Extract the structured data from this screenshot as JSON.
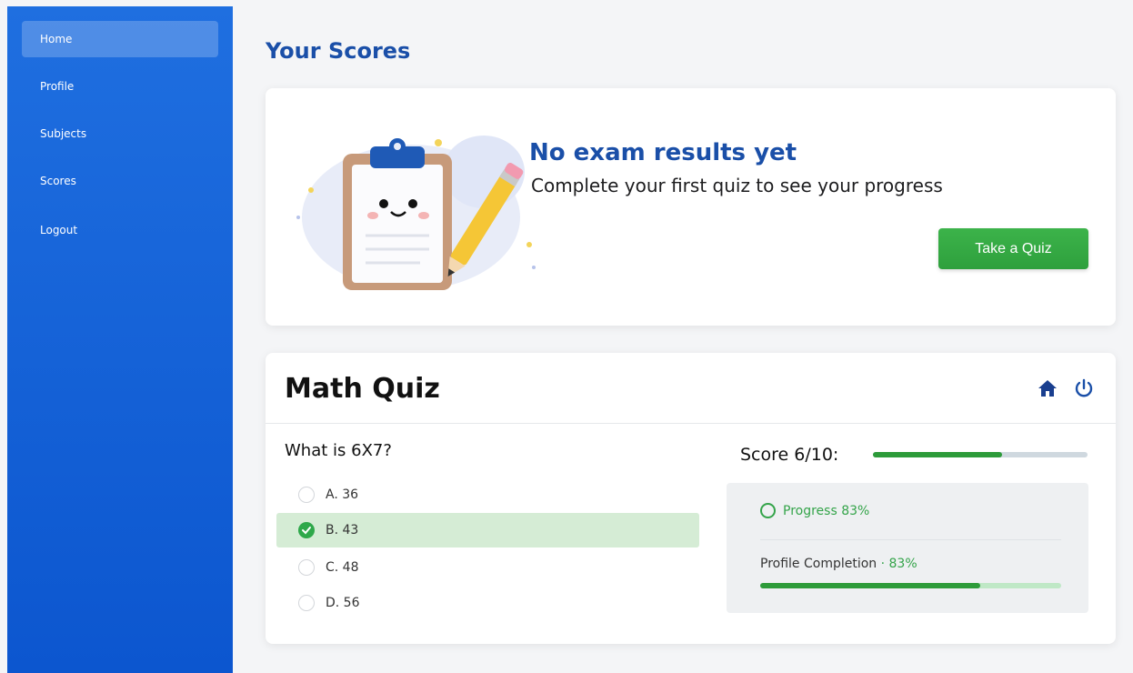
{
  "sidebar": {
    "items": [
      {
        "label": "Home",
        "active": true
      },
      {
        "label": "Profile"
      },
      {
        "label": "Subjects"
      },
      {
        "label": "Scores"
      },
      {
        "label": "Logout"
      }
    ]
  },
  "page": {
    "title": "Your Scores"
  },
  "empty_state": {
    "illustration": "clipboard-pencil-illustration",
    "title": "No exam results yet",
    "subtitle": "Complete your first quiz to see your progress",
    "button_label": "Take a Quiz"
  },
  "quiz": {
    "title": "Math Quiz",
    "header_icons": [
      "home-icon",
      "power-icon"
    ],
    "question": "What is 6X7?",
    "options": [
      {
        "label": "A. 36",
        "selected": false
      },
      {
        "label": "B. 43",
        "selected": true
      },
      {
        "label": "C. 48",
        "selected": false
      },
      {
        "label": "D. 56",
        "selected": false
      }
    ],
    "score_label": "Score 6/10:",
    "score_fraction": 0.6,
    "progress_label": "Progress 83%",
    "profile_completion_label": "Profile Completion",
    "profile_completion_pct_text": "83%",
    "profile_completion_fraction": 0.73
  },
  "colors": {
    "sidebar": "#0c56cf",
    "title_blue": "#1a4fa8",
    "button_green": "#2ea03d",
    "selected_bg": "#d5ecd5",
    "progress_green": "#2d9b3a"
  }
}
